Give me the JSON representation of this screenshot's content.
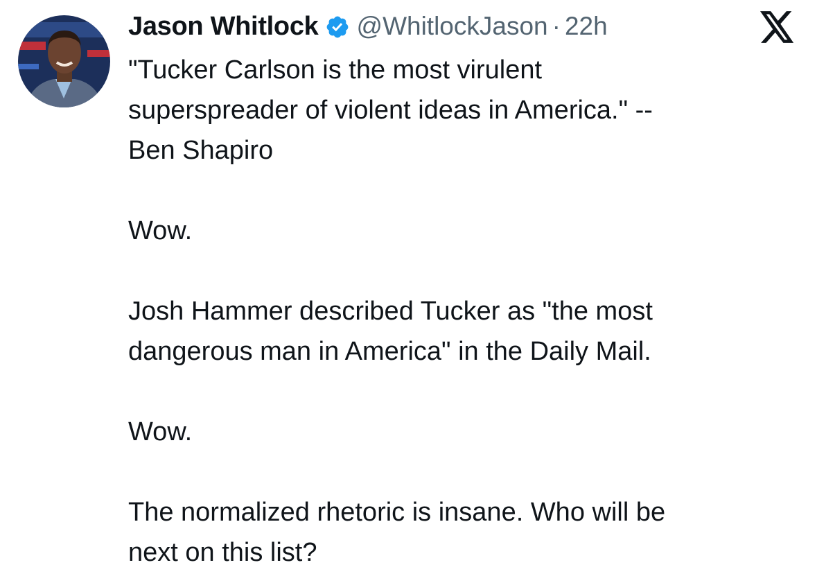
{
  "author": {
    "display_name": "Jason Whitlock",
    "handle": "@WhitlockJason",
    "separator": "·",
    "time_ago": "22h",
    "verified": true,
    "verified_color": "#1d9bf0"
  },
  "icons": {
    "avatar": "profile-photo",
    "verified": "verified-badge-icon",
    "brand": "x-logo-icon"
  },
  "tweet": {
    "paragraphs": [
      "\"Tucker Carlson is the most virulent\nsuperspreader of violent ideas in America.\" --\nBen Shapiro",
      "Wow.",
      "Josh Hammer described Tucker as \"the most\ndangerous man in America\" in the Daily Mail.",
      "Wow.",
      "The normalized rhetoric is insane. Who will be\nnext on this list?"
    ]
  },
  "colors": {
    "text": "#0f1419",
    "secondary_text": "#536471",
    "background": "#ffffff"
  }
}
